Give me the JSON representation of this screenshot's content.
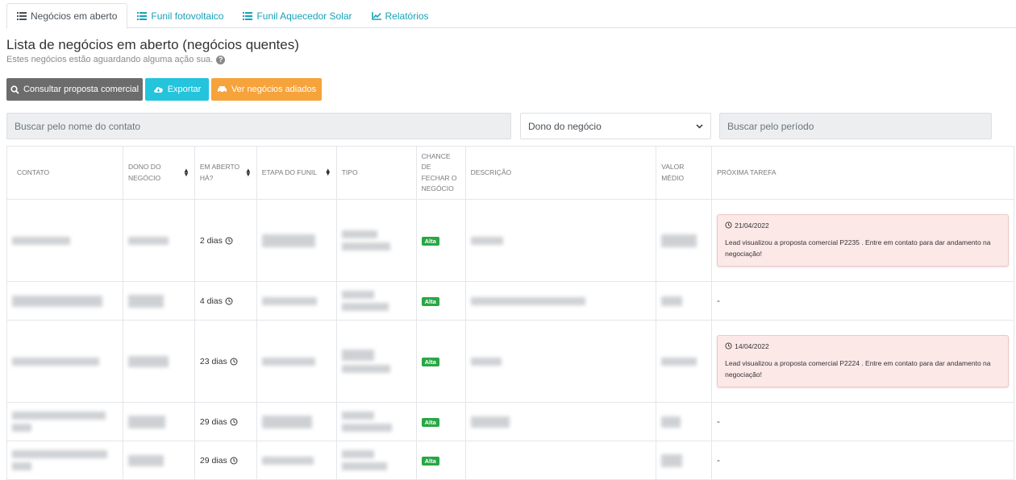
{
  "tabs": [
    {
      "label": "Negócios em aberto",
      "icon": "list-icon",
      "active": true
    },
    {
      "label": "Funil fotovoltaico",
      "icon": "list-icon",
      "active": false
    },
    {
      "label": "Funil Aquecedor Solar",
      "icon": "list-icon",
      "active": false
    },
    {
      "label": "Relatórios",
      "icon": "line-chart-icon",
      "active": false
    }
  ],
  "page": {
    "title": "Lista de negócios em aberto (negócios quentes)",
    "subtitle": "Estes negócios estão aguardando alguma ação sua."
  },
  "actions": {
    "consult": "Consultar proposta comercial",
    "export": "Exportar",
    "postponed": "Ver negócios adiados"
  },
  "filters": {
    "contact_placeholder": "Buscar pelo nome do contato",
    "owner_selected": "Dono do negócio",
    "period_placeholder": "Buscar pelo período"
  },
  "table": {
    "headers": {
      "contact": "Contato",
      "owner": "Dono do negócio",
      "open": "Em aberto há?",
      "stage": "Etapa do funil",
      "type": "Tipo",
      "chance": "Chance de fechar o negócio",
      "description": "Descrição",
      "value": "Valor médio",
      "next_task": "Próxima tarefa"
    },
    "rows": [
      {
        "open": "2 dias",
        "chance": "Alta",
        "task_date": "21/04/2022",
        "task_text": "Lead visualizou a proposta comercial P2235 . Entre em contato para dar andamento na negociação!"
      },
      {
        "open": "4 dias",
        "chance": "Alta",
        "task_none": "-"
      },
      {
        "open": "23 dias",
        "chance": "Alta",
        "task_date": "14/04/2022",
        "task_text": "Lead visualizou a proposta comercial P2224 . Entre em contato para dar andamento na negociação!"
      },
      {
        "open": "29 dias",
        "chance": "Alta",
        "task_none": "-"
      },
      {
        "open": "29 dias",
        "chance": "Alta",
        "task_none": "-"
      }
    ]
  },
  "colors": {
    "accent": "#17a2b8",
    "btn_gray": "#6c6c6c",
    "btn_cyan": "#23c4dc",
    "btn_orange": "#f6a33b",
    "badge_green": "#28a745",
    "task_bg": "#fde8e8"
  }
}
